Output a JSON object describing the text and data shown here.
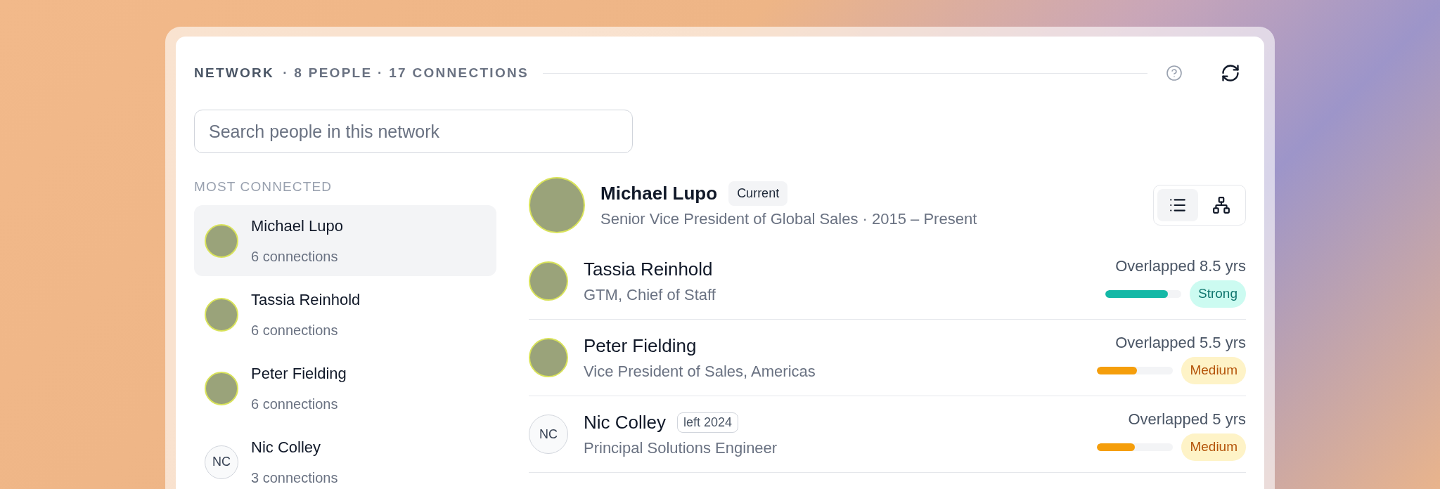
{
  "header": {
    "title": "NETWORK",
    "stats": "· 8 PEOPLE · 17 CONNECTIONS"
  },
  "search": {
    "placeholder": "Search people in this network"
  },
  "sidebar": {
    "heading": "MOST CONNECTED",
    "items": [
      {
        "name": "Michael Lupo",
        "connections": "6 connections",
        "avatar": {
          "kind": "photo"
        },
        "selected": true
      },
      {
        "name": "Tassia Reinhold",
        "connections": "6 connections",
        "avatar": {
          "kind": "photo"
        },
        "selected": false
      },
      {
        "name": "Peter Fielding",
        "connections": "6 connections",
        "avatar": {
          "kind": "photo"
        },
        "selected": false
      },
      {
        "name": "Nic Colley",
        "connections": "3 connections",
        "avatar": {
          "kind": "initials",
          "initials": "NC"
        },
        "selected": false
      }
    ]
  },
  "current": {
    "name": "Michael Lupo",
    "badge": "Current",
    "subtitle": "Senior Vice President of Global Sales · 2015 – Present",
    "avatar": {
      "kind": "photo"
    },
    "view_toggle": [
      {
        "kind": "list",
        "selected": true
      },
      {
        "kind": "tree",
        "selected": false
      }
    ]
  },
  "connections": [
    {
      "name": "Tassia Reinhold",
      "title": "GTM, Chief of Staff",
      "avatar": {
        "kind": "photo"
      },
      "overlap": "Overlapped 8.5 yrs",
      "level": 0.82,
      "strength": {
        "label": "Strong",
        "kind": "strong"
      }
    },
    {
      "name": "Peter Fielding",
      "title": "Vice President of Sales, Americas",
      "avatar": {
        "kind": "photo"
      },
      "overlap": "Overlapped 5.5 yrs",
      "level": 0.52,
      "strength": {
        "label": "Medium",
        "kind": "medium"
      }
    },
    {
      "name": "Nic Colley",
      "tag": "left 2024",
      "title": "Principal Solutions Engineer",
      "avatar": {
        "kind": "initials",
        "initials": "NC"
      },
      "overlap": "Overlapped 5 yrs",
      "level": 0.5,
      "strength": {
        "label": "Medium",
        "kind": "medium"
      }
    }
  ]
}
